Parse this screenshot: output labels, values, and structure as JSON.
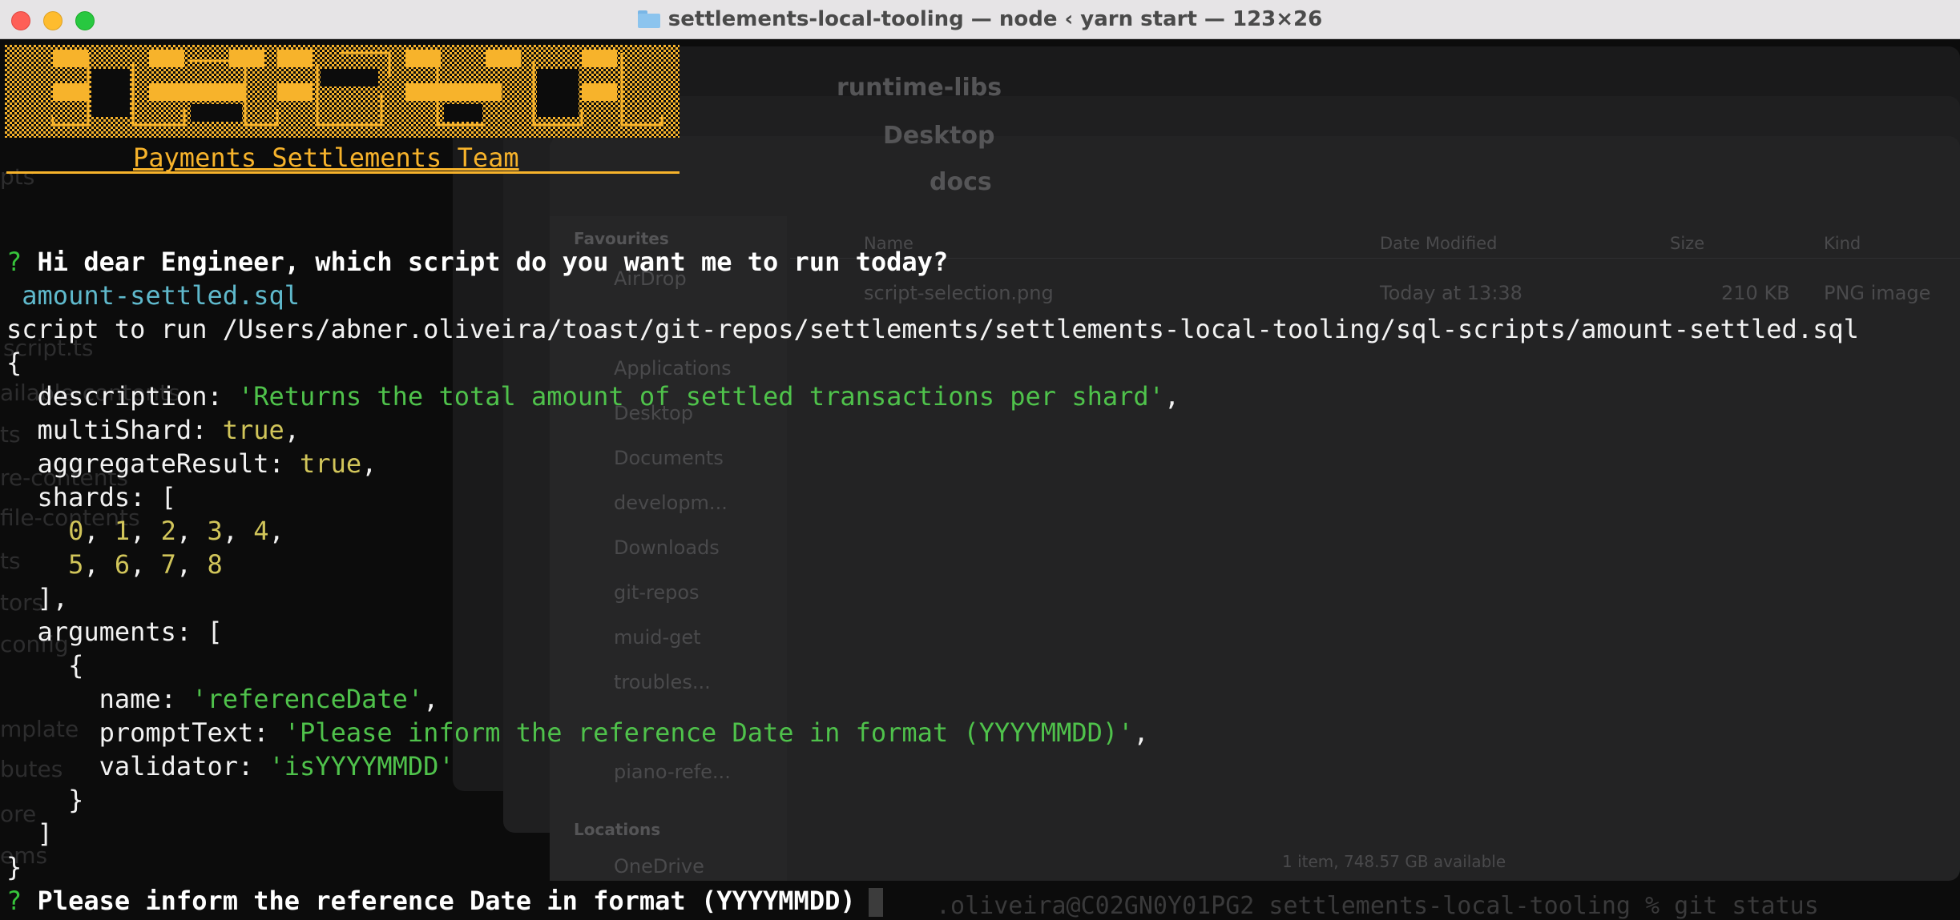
{
  "window": {
    "title": "settlements-local-tooling — node ‹ yarn start — 123×26"
  },
  "banner": {
    "team_name": "Payments Settlements Team",
    "color": "#f7b32b"
  },
  "background_finder": {
    "back_window_title": "runtime-libs",
    "mid_window_title": "Desktop",
    "front_window_title": "docs",
    "columns": [
      "Name",
      "Date Modified",
      "Size",
      "Kind"
    ],
    "sidebar_heading": "Favourites",
    "sidebar_items": [
      "AirDrop",
      "Applications",
      "Desktop",
      "Documents",
      "developm...",
      "Downloads",
      "git-repos",
      "muid-get",
      "troubles...",
      "piano-refe..."
    ],
    "locations_heading": "Locations",
    "locations_items": [
      "OneDrive"
    ],
    "file": {
      "name": "script-selection.png",
      "date": "Today at 13:38",
      "size": "210 KB",
      "kind": "PNG image"
    },
    "status": "1 item, 748.57 GB available"
  },
  "left_ghost": [
    "pts",
    "script.ts",
    "ailable-contents",
    "ts",
    "re-contents",
    "file-contents",
    "ts",
    "tors",
    "config",
    "mplate",
    "butes",
    "ore",
    "ems"
  ],
  "terminal": {
    "question_mark": "?",
    "prompt1": "Hi dear Engineer, which script do you want me to run today?",
    "answer1": "amount-settled.sql",
    "script_line": "script to run /Users/abner.oliveira/toast/git-repos/settlements/settlements-local-tooling/sql-scripts/amount-settled.sql",
    "open_brace": "{",
    "close_brace": "}",
    "desc_key": "  description: ",
    "desc_val": "'Returns the total amount of settled transactions per shard'",
    "multishard_key": "  multiShard: ",
    "multishard_val": "true",
    "aggregate_key": "  aggregateResult: ",
    "aggregate_val": "true",
    "shards_key": "  shards: [",
    "shards_row1": [
      "0",
      "1",
      "2",
      "3",
      "4"
    ],
    "shards_row2": [
      "5",
      "6",
      "7",
      "8"
    ],
    "shards_close": "  ],",
    "args_key": "  arguments: [",
    "args_obj_open": "    {",
    "name_key": "      name: ",
    "name_val": "'referenceDate'",
    "prompt_key": "      promptText: ",
    "prompt_val": "'Please inform the reference Date in format (YYYYMMDD)'",
    "validator_key": "      validator: ",
    "validator_val": "'isYYYYMMDD'",
    "args_obj_close": "    }",
    "args_close": "  ]",
    "prompt2": "Please inform the reference Date in format (YYYYMMDD)",
    "behind_text": ".oliveira@C02GN0Y01PG2 settlements-local-tooling % git status"
  }
}
